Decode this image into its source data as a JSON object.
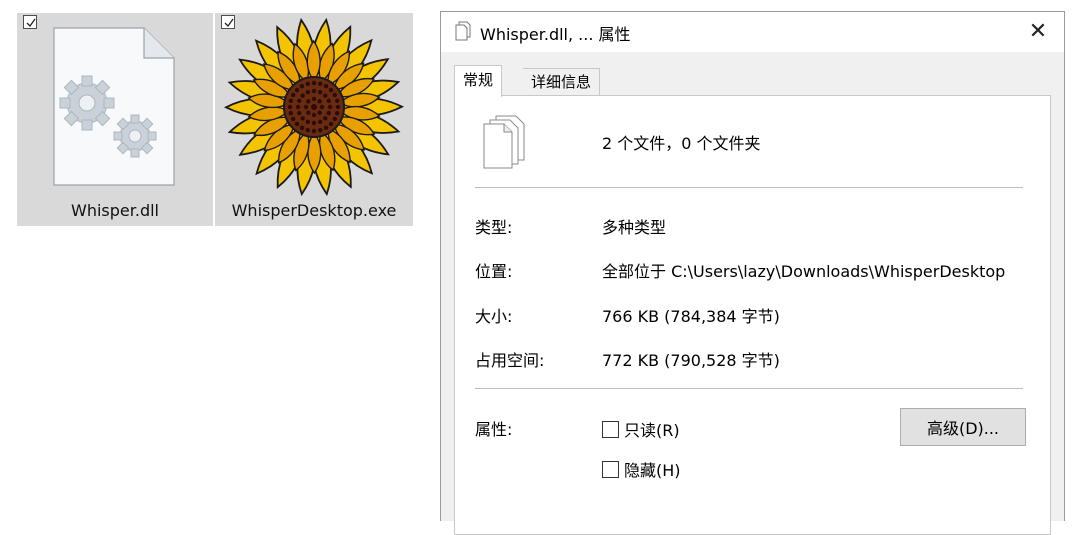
{
  "files": [
    {
      "name": "Whisper.dll",
      "icon": "dll-gears-icon",
      "checked": true
    },
    {
      "name": "WhisperDesktop.exe",
      "icon": "sunflower-icon",
      "checked": true
    }
  ],
  "dialog": {
    "title": "Whisper.dll, ... 属性",
    "close_glyph": "✕",
    "tabs": [
      {
        "label": "常规",
        "active": true
      },
      {
        "label": "详细信息",
        "active": false
      }
    ],
    "summary": "2 个文件，0 个文件夹",
    "fields": [
      {
        "label": "类型:",
        "value": "多种类型"
      },
      {
        "label": "位置:",
        "value": "全部位于 C:\\Users\\lazy\\Downloads\\WhisperDesktop"
      },
      {
        "label": "大小:",
        "value": "766 KB (784,384 字节)"
      },
      {
        "label": "占用空间:",
        "value": "772 KB (790,528 字节)"
      }
    ],
    "attributes": {
      "label": "属性:",
      "readonly": {
        "label": "只读(R)",
        "checked": false
      },
      "hidden": {
        "label": "隐藏(H)",
        "checked": false
      },
      "advanced_button": "高级(D)..."
    }
  },
  "colors": {
    "tile_bg": "#d9d9d9",
    "dialog_bg": "#f0f0f0",
    "sunflower_petal": "#f5c400",
    "sunflower_center": "#6b2a12"
  }
}
